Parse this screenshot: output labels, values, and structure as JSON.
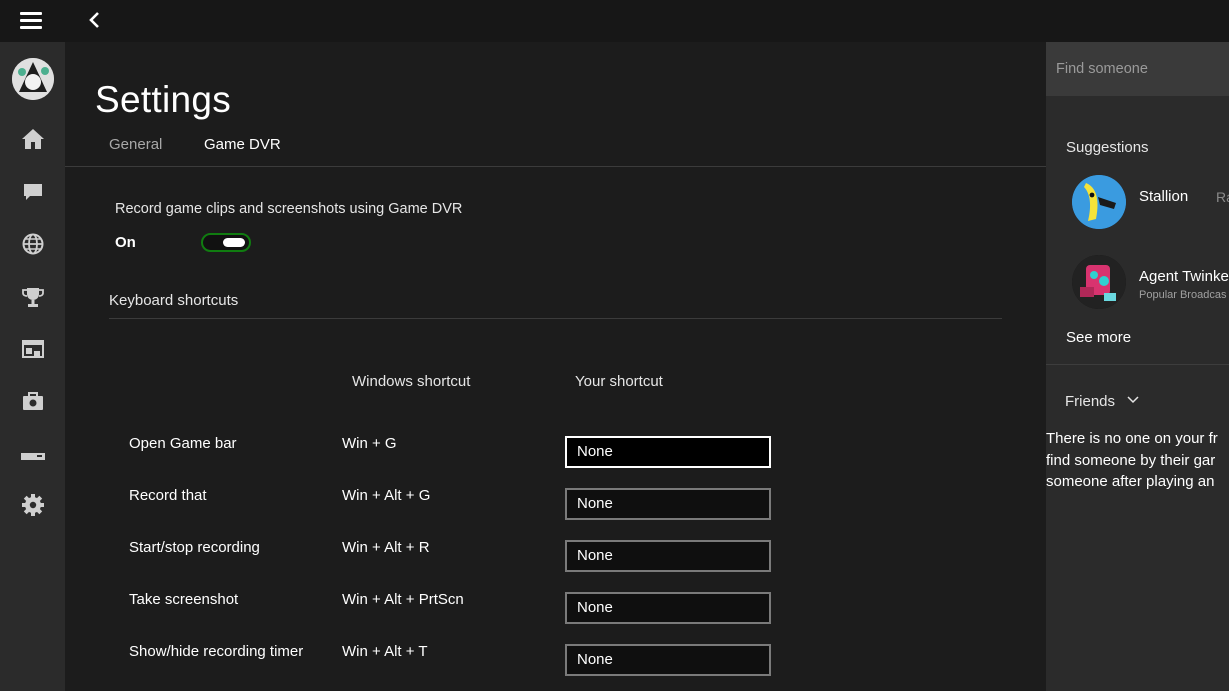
{
  "header": {
    "menu_icon": "hamburger-icon",
    "back_icon": "back-arrow-icon"
  },
  "nav": {
    "items": [
      {
        "icon": "home-icon"
      },
      {
        "icon": "messages-icon"
      },
      {
        "icon": "activity-globe-icon"
      },
      {
        "icon": "achievements-trophy-icon"
      },
      {
        "icon": "game-dvr-icon"
      },
      {
        "icon": "store-icon"
      },
      {
        "icon": "connect-console-icon"
      },
      {
        "icon": "settings-gear-icon"
      }
    ]
  },
  "settings": {
    "title": "Settings",
    "tabs": [
      {
        "label": "General",
        "selected": false
      },
      {
        "label": "Game DVR",
        "selected": true
      }
    ],
    "record_label": "Record game clips and screenshots using Game DVR",
    "toggle_state": "On",
    "keyboard_label": "Keyboard shortcuts",
    "columns": {
      "windows": "Windows shortcut",
      "yours": "Your shortcut"
    },
    "shortcuts": [
      {
        "action": "Open Game bar",
        "windows": "Win + G",
        "yours": "None"
      },
      {
        "action": "Record that",
        "windows": "Win + Alt + G",
        "yours": "None"
      },
      {
        "action": "Start/stop recording",
        "windows": "Win + Alt + R",
        "yours": "None"
      },
      {
        "action": "Take screenshot",
        "windows": "Win + Alt + PrtScn",
        "yours": "None"
      },
      {
        "action": "Show/hide recording timer",
        "windows": "Win + Alt + T",
        "yours": "None"
      }
    ]
  },
  "social": {
    "search_placeholder": "Find someone",
    "suggestions_label": "Suggestions",
    "suggestions": [
      {
        "name": "Stallion",
        "extra": "Ra",
        "subtitle": ""
      },
      {
        "name": "Agent Twinke",
        "extra": "",
        "subtitle": "Popular Broadcas"
      }
    ],
    "see_more": "See more",
    "friends_label": "Friends",
    "friends_empty_lines": [
      "There is no one on your fr",
      "find someone by their gar",
      "someone after playing an"
    ]
  },
  "colors": {
    "accent_green": "#107c10",
    "rail_bg": "#2b2b2b",
    "main_bg": "#1c1c1c"
  }
}
